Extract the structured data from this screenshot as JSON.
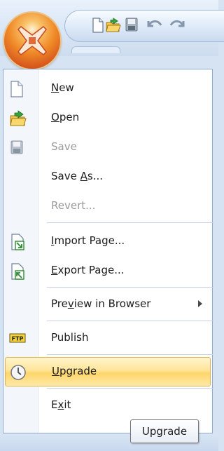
{
  "menu": {
    "items": [
      {
        "label": "New",
        "icon": "new-document-icon",
        "mnemonic": "N",
        "rest": "ew"
      },
      {
        "label": "Open",
        "icon": "open-folder-icon",
        "mnemonic": "O",
        "rest": "pen"
      },
      {
        "label": "Save",
        "icon": "save-disk-icon",
        "disabled": true
      },
      {
        "label": "Save As...",
        "prefix": "Save ",
        "mnemonic": "A",
        "rest": "s..."
      },
      {
        "label": "Revert...",
        "disabled": true
      },
      {
        "label": "Import Page...",
        "icon": "import-page-icon",
        "mnemonic": "I",
        "rest": "mport Page..."
      },
      {
        "label": "Export Page...",
        "icon": "export-page-icon",
        "mnemonic": "E",
        "rest": "xport Page..."
      },
      {
        "label": "Preview in Browser",
        "prefix": "Pre",
        "mnemonic": "v",
        "rest": "iew in Browser",
        "submenu": true
      },
      {
        "label": "Publish",
        "icon": "ftp-icon"
      },
      {
        "label": "Upgrade",
        "icon": "clock-icon",
        "highlighted": true,
        "mnemonic": "U",
        "rest": "pgrade"
      },
      {
        "label": "Exit",
        "prefix": "E",
        "mnemonic": "x",
        "rest": "it"
      }
    ]
  },
  "tooltip": {
    "text": "Upgrade"
  },
  "colors": {
    "highlight": "#ffe59a",
    "highlight_border": "#e3b34b",
    "orb": "#f08a28",
    "chrome": "#d5e3f3"
  }
}
